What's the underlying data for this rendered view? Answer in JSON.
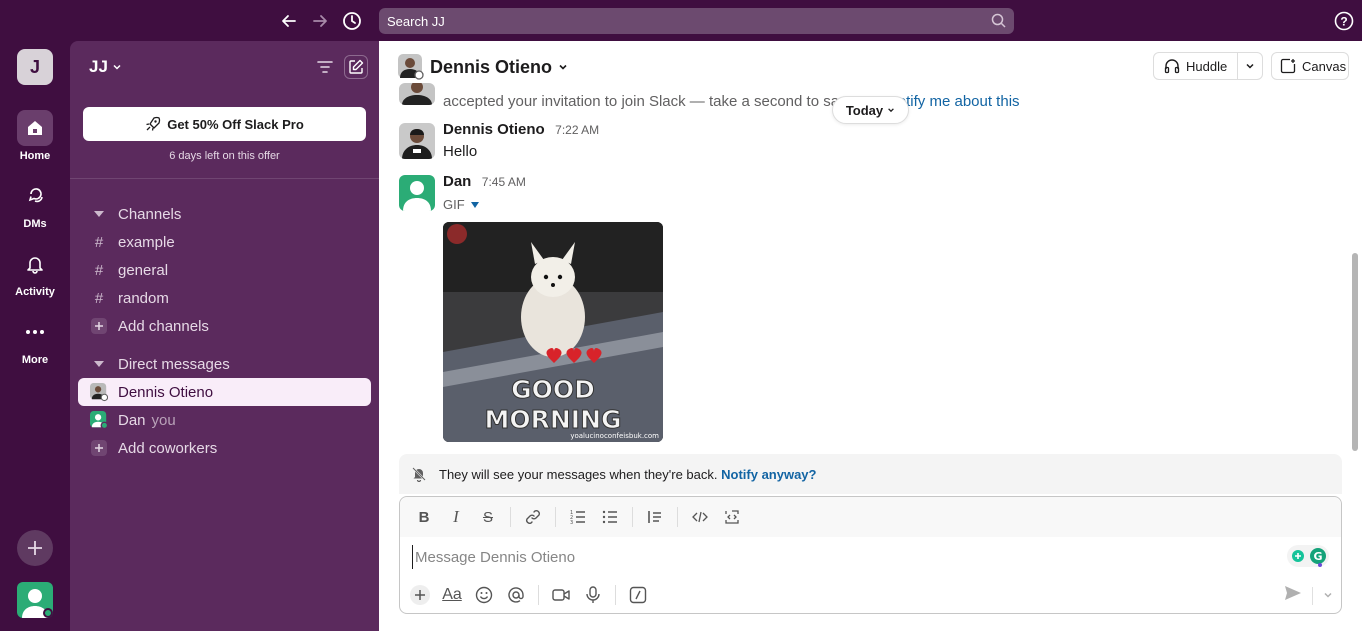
{
  "search": {
    "placeholder": "Search JJ"
  },
  "workspace": {
    "initial": "J",
    "name": "JJ"
  },
  "rail": [
    {
      "label": "Home",
      "icon": "home-icon"
    },
    {
      "label": "DMs",
      "icon": "dms-icon"
    },
    {
      "label": "Activity",
      "icon": "bell-icon"
    },
    {
      "label": "More",
      "icon": "more-icon"
    }
  ],
  "promo": {
    "button": "Get 50% Off Slack Pro",
    "subtext": "6 days left on this offer"
  },
  "sidebar": {
    "channels_header": "Channels",
    "channels": [
      "example",
      "general",
      "random"
    ],
    "add_channels": "Add channels",
    "dms_header": "Direct messages",
    "dms": [
      {
        "name": "Dennis Otieno"
      },
      {
        "name": "Dan",
        "suffix": "you"
      }
    ],
    "add_coworkers": "Add coworkers"
  },
  "channel": {
    "title": "Dennis Otieno",
    "huddle": "Huddle",
    "canvas": "Canvas"
  },
  "messages": {
    "system_text": "accepted your invitation to join Slack — take a second to say",
    "system_link": "Don't notify me about this",
    "today": "Today",
    "m1": {
      "author": "Dennis Otieno",
      "time": "7:22 AM",
      "text": "Hello"
    },
    "m2": {
      "author": "Dan",
      "time": "7:45 AM",
      "gif_label": "GIF",
      "gif_line1": "GOOD",
      "gif_line2": "MORNING",
      "gif_watermark": "yoalucinoconfeisbuk.com"
    }
  },
  "notice": {
    "text": "They will see your messages when they're back.",
    "link": "Notify anyway?"
  },
  "composer": {
    "placeholder": "Message Dennis Otieno",
    "value": ""
  },
  "colors": {
    "aubergine": "#3f0e40",
    "sidebar": "#5b2a5d",
    "link": "#1264a3",
    "green": "#2bac76"
  }
}
